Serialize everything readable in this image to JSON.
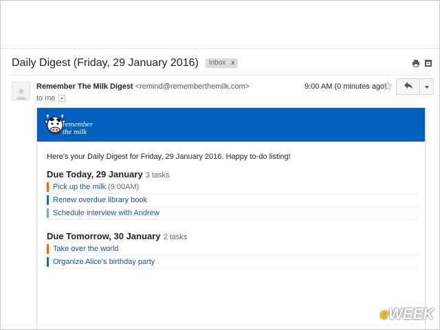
{
  "message": {
    "subject": "Daily Digest (Friday, 29 January 2016)",
    "label": "Inbox",
    "label_remove": "x"
  },
  "sender": {
    "name": "Remember The Milk Digest",
    "email": "<remind@rememberthemilk.com>",
    "recipient": "to me",
    "time": "9:00 AM (0 minutes ago)"
  },
  "banner": {
    "logo_line1": "remember",
    "logo_line2": "the milk",
    "color": "#0060bf"
  },
  "body": {
    "greeting": "Here's your Daily Digest for Friday, 29 January 2016. Happy to-do listing!",
    "sections": [
      {
        "title": "Due Today, 29 January",
        "count": "3 tasks",
        "tasks": [
          {
            "title": "Pick up the milk",
            "extra": "(9:00AM)",
            "priority_color": "#e06d10"
          },
          {
            "title": "Renew overdue library book",
            "extra": "",
            "priority_color": "#1f65b5"
          },
          {
            "title": "Schedule interview with Andrew",
            "extra": "",
            "priority_color": "#6fa6e0"
          }
        ]
      },
      {
        "title": "Due Tomorrow, 30 January",
        "count": "2 tasks",
        "tasks": [
          {
            "title": "Take over the world",
            "extra": "",
            "priority_color": "#e06d10"
          },
          {
            "title": "Organize Alice's birthday party",
            "extra": "",
            "priority_color": "#1f65b5"
          }
        ]
      }
    ]
  },
  "icons": {
    "print": "print-icon",
    "new_window": "new-window-icon",
    "star": "star-icon",
    "reply": "reply-icon",
    "more": "chevron-down-icon",
    "avatar": "avatar-icon"
  },
  "watermark": {
    "e": "e",
    "rest": "WEEK"
  }
}
